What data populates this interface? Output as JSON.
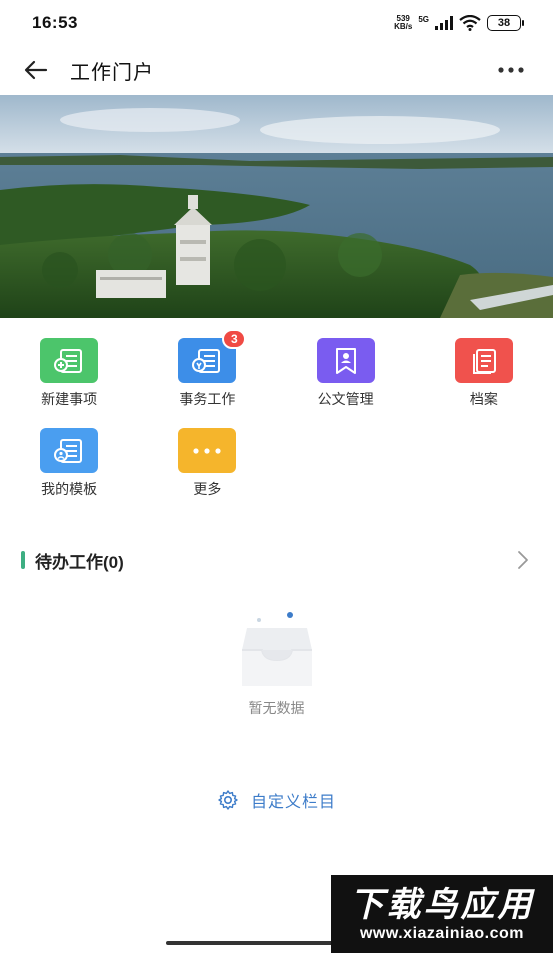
{
  "status_bar": {
    "time": "16:53",
    "net_speed_value": "539",
    "net_speed_unit": "KB/s",
    "network": "5G",
    "battery": "38"
  },
  "header": {
    "title": "工作门户"
  },
  "apps": [
    {
      "label": "新建事项",
      "icon": "new-item-icon",
      "color": "#4cc56b"
    },
    {
      "label": "事务工作",
      "icon": "affairs-icon",
      "color": "#3d8ee8",
      "badge": "3"
    },
    {
      "label": "公文管理",
      "icon": "document-icon",
      "color": "#7a5cf0"
    },
    {
      "label": "档案",
      "icon": "archive-icon",
      "color": "#f0524d"
    },
    {
      "label": "我的模板",
      "icon": "template-icon",
      "color": "#4a9ef0"
    },
    {
      "label": "更多",
      "icon": "more-icon",
      "color": "#f5b52c"
    }
  ],
  "todo_section": {
    "title": "待办工作(0)"
  },
  "empty_state": {
    "text": "暂无数据"
  },
  "customize": {
    "label": "自定义栏目"
  },
  "watermark": {
    "title": "下载鸟应用",
    "url": "www.xiazainiao.com"
  },
  "colors": {
    "accent_green": "#3dae82",
    "link_blue": "#3d7cc9",
    "badge_red": "#f04a44"
  }
}
